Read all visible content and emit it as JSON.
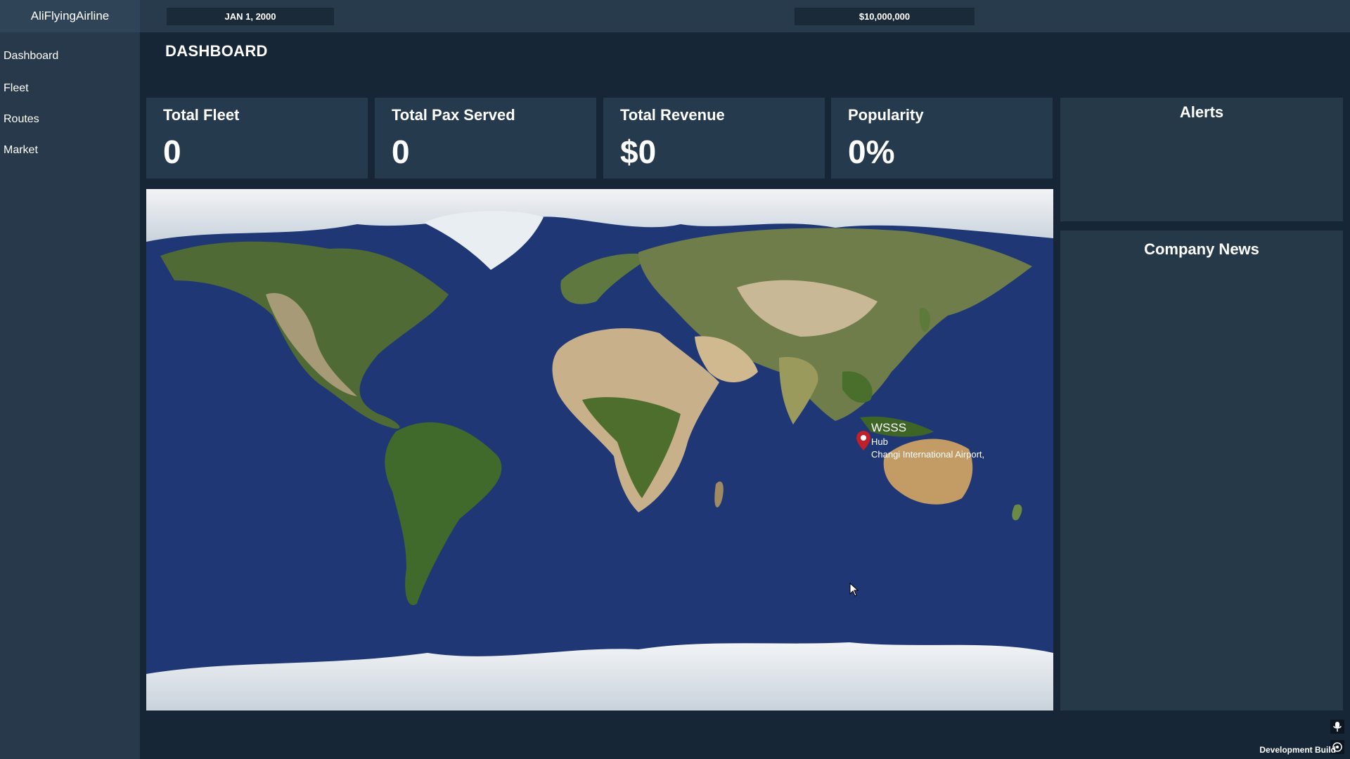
{
  "app": {
    "name": "AliFlyingAirline"
  },
  "sidebar": {
    "items": [
      {
        "label": "Dashboard"
      },
      {
        "label": "Fleet"
      },
      {
        "label": "Routes"
      },
      {
        "label": "Market"
      }
    ]
  },
  "topbar": {
    "date": "JAN 1, 2000",
    "money": "$10,000,000"
  },
  "page": {
    "title": "DASHBOARD"
  },
  "stats": [
    {
      "label": "Total Fleet",
      "value": "0"
    },
    {
      "label": "Total Pax Served",
      "value": "0"
    },
    {
      "label": "Total Revenue",
      "value": "$0"
    },
    {
      "label": "Popularity",
      "value": "0%"
    }
  ],
  "panels": {
    "alerts_title": "Alerts",
    "news_title": "Company News"
  },
  "map": {
    "marker": {
      "code": "WSSS",
      "type": "Hub",
      "name": "Changi International Airport,"
    },
    "icons": {
      "marker": "map-pin-icon"
    }
  },
  "footer": {
    "build_label": "Development Build"
  },
  "colors": {
    "background": "#172636",
    "sidebar": "#27394a",
    "card": "#263a4d",
    "ocean": "#1f3875",
    "marker": "#c0202a"
  }
}
